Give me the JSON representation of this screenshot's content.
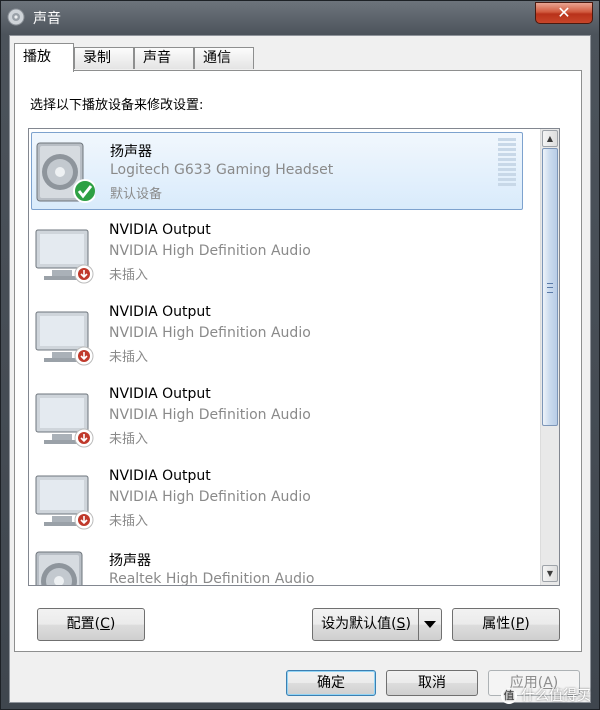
{
  "window": {
    "title": "声音",
    "close_glyph": "✕"
  },
  "tabs": [
    {
      "label": "播放",
      "active": true
    },
    {
      "label": "录制",
      "active": false
    },
    {
      "label": "声音",
      "active": false
    },
    {
      "label": "通信",
      "active": false
    }
  ],
  "instruction": "选择以下播放设备来修改设置:",
  "devices": [
    {
      "name": "扬声器",
      "description": "Logitech G633 Gaming Headset",
      "status": "默认设备",
      "icon": "speaker-icon",
      "badge": "default-check-icon",
      "selected": true
    },
    {
      "name": "NVIDIA Output",
      "description": "NVIDIA High Definition Audio",
      "status": "未插入",
      "icon": "monitor-icon",
      "badge": "unplugged-icon",
      "selected": false
    },
    {
      "name": "NVIDIA Output",
      "description": "NVIDIA High Definition Audio",
      "status": "未插入",
      "icon": "monitor-icon",
      "badge": "unplugged-icon",
      "selected": false
    },
    {
      "name": "NVIDIA Output",
      "description": "NVIDIA High Definition Audio",
      "status": "未插入",
      "icon": "monitor-icon",
      "badge": "unplugged-icon",
      "selected": false
    },
    {
      "name": "NVIDIA Output",
      "description": "NVIDIA High Definition Audio",
      "status": "未插入",
      "icon": "monitor-icon",
      "badge": "unplugged-icon",
      "selected": false
    },
    {
      "name": "扬声器",
      "description": "Realtek High Definition Audio",
      "status": "",
      "icon": "speaker-icon",
      "badge": "",
      "selected": false
    }
  ],
  "buttons": {
    "configure": {
      "text": "配置",
      "accel": "C"
    },
    "set_default": {
      "text": "设为默认值",
      "accel": "S"
    },
    "properties": {
      "text": "属性",
      "accel": "P"
    },
    "ok": "确定",
    "cancel": "取消",
    "apply": {
      "text": "应用",
      "accel": "A"
    }
  },
  "watermark": {
    "logo": "值",
    "text": "什么值得买"
  },
  "colors": {
    "selection": "#d9ebfb",
    "selection_border": "#7da2ce",
    "check_green": "#2ea043",
    "unplugged_red": "#c0392b",
    "close_red": "#c9462a"
  }
}
